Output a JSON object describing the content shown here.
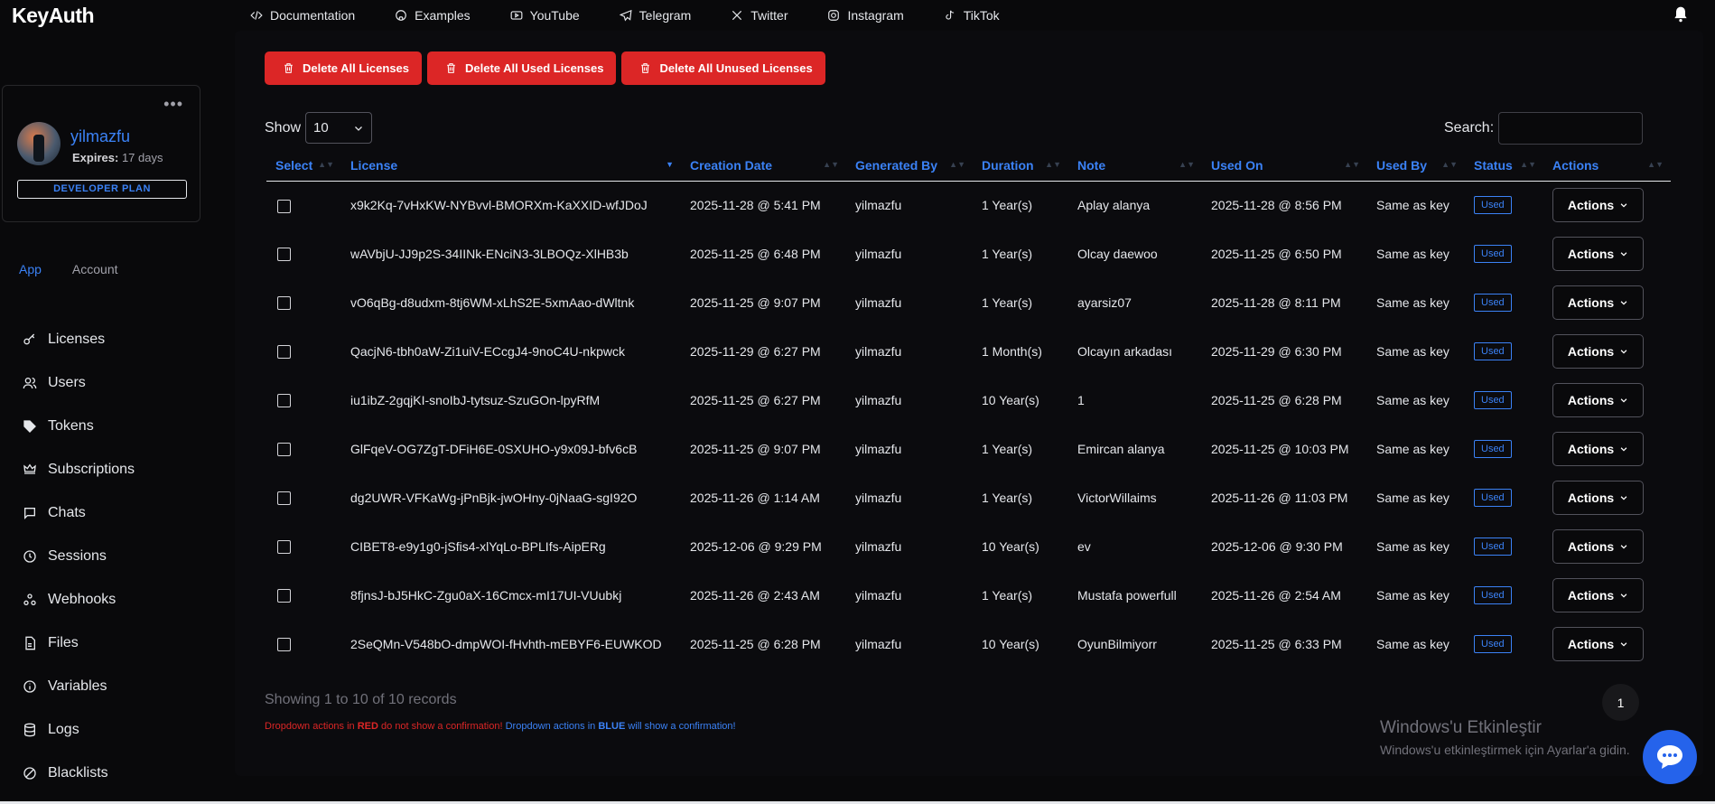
{
  "app": {
    "logo": "KeyAuth"
  },
  "topnav": [
    {
      "label": "Documentation",
      "icon": "code-icon"
    },
    {
      "label": "Examples",
      "icon": "github-icon"
    },
    {
      "label": "YouTube",
      "icon": "youtube-icon"
    },
    {
      "label": "Telegram",
      "icon": "telegram-icon"
    },
    {
      "label": "Twitter",
      "icon": "x-icon"
    },
    {
      "label": "Instagram",
      "icon": "instagram-icon"
    },
    {
      "label": "TikTok",
      "icon": "tiktok-icon"
    }
  ],
  "profile": {
    "username": "yilmazfu",
    "expires_label": "Expires:",
    "expires_value": "17 days",
    "plan": "DEVELOPER PLAN",
    "menu_dots": "•••"
  },
  "sidetabs": {
    "app": "App",
    "account": "Account"
  },
  "sidebar": [
    {
      "label": "Licenses"
    },
    {
      "label": "Users"
    },
    {
      "label": "Tokens"
    },
    {
      "label": "Subscriptions"
    },
    {
      "label": "Chats"
    },
    {
      "label": "Sessions"
    },
    {
      "label": "Webhooks"
    },
    {
      "label": "Files"
    },
    {
      "label": "Variables"
    },
    {
      "label": "Logs"
    },
    {
      "label": "Blacklists"
    }
  ],
  "actions_bar": {
    "delete_all": "Delete All Licenses",
    "delete_used": "Delete All Used Licenses",
    "delete_unused": "Delete All Unused Licenses"
  },
  "controls": {
    "show_label": "Show",
    "page_size": "10",
    "search_label": "Search:"
  },
  "table": {
    "headers": [
      "Select",
      "License",
      "Creation Date",
      "Generated By",
      "Duration",
      "Note",
      "Used On",
      "Used By",
      "Status",
      "Actions"
    ],
    "rows": [
      {
        "license": "x9k2Kq-7vHxKW-NYBvvl-BMORXm-KaXXID-wfJDoJ",
        "created": "2025-11-28 @ 5:41 PM",
        "by": "yilmazfu",
        "duration": "1 Year(s)",
        "note": "Aplay alanya",
        "used_on": "2025-11-28 @ 8:56 PM",
        "used_by": "Same as key",
        "status": "Used",
        "action": "Actions"
      },
      {
        "license": "wAVbjU-JJ9p2S-34IINk-ENciN3-3LBOQz-XlHB3b",
        "created": "2025-11-25 @ 6:48 PM",
        "by": "yilmazfu",
        "duration": "1 Year(s)",
        "note": "Olcay daewoo",
        "used_on": "2025-11-25 @ 6:50 PM",
        "used_by": "Same as key",
        "status": "Used",
        "action": "Actions"
      },
      {
        "license": "vO6qBg-d8udxm-8tj6WM-xLhS2E-5xmAao-dWltnk",
        "created": "2025-11-25 @ 9:07 PM",
        "by": "yilmazfu",
        "duration": "1 Year(s)",
        "note": "ayarsiz07",
        "used_on": "2025-11-28 @ 8:11 PM",
        "used_by": "Same as key",
        "status": "Used",
        "action": "Actions"
      },
      {
        "license": "QacjN6-tbh0aW-Zi1uiV-ECcgJ4-9noC4U-nkpwck",
        "created": "2025-11-29 @ 6:27 PM",
        "by": "yilmazfu",
        "duration": "1 Month(s)",
        "note": "Olcayın arkadası",
        "used_on": "2025-11-29 @ 6:30 PM",
        "used_by": "Same as key",
        "status": "Used",
        "action": "Actions"
      },
      {
        "license": "iu1ibZ-2gqjKI-snoIbJ-tytsuz-SzuGOn-lpyRfM",
        "created": "2025-11-25 @ 6:27 PM",
        "by": "yilmazfu",
        "duration": "10 Year(s)",
        "note": "1",
        "used_on": "2025-11-25 @ 6:28 PM",
        "used_by": "Same as key",
        "status": "Used",
        "action": "Actions"
      },
      {
        "license": "GlFqeV-OG7ZgT-DFiH6E-0SXUHO-y9x09J-bfv6cB",
        "created": "2025-11-25 @ 9:07 PM",
        "by": "yilmazfu",
        "duration": "1 Year(s)",
        "note": "Emircan alanya",
        "used_on": "2025-11-25 @ 10:03 PM",
        "used_by": "Same as key",
        "status": "Used",
        "action": "Actions"
      },
      {
        "license": "dg2UWR-VFKaWg-jPnBjk-jwOHny-0jNaaG-sgI92O",
        "created": "2025-11-26 @ 1:14 AM",
        "by": "yilmazfu",
        "duration": "1 Year(s)",
        "note": "VictorWillaims",
        "used_on": "2025-11-26 @ 11:03 PM",
        "used_by": "Same as key",
        "status": "Used",
        "action": "Actions"
      },
      {
        "license": "CIBET8-e9y1g0-jSfis4-xlYqLo-BPLIfs-AipERg",
        "created": "2025-12-06 @ 9:29 PM",
        "by": "yilmazfu",
        "duration": "10 Year(s)",
        "note": "ev",
        "used_on": "2025-12-06 @ 9:30 PM",
        "used_by": "Same as key",
        "status": "Used",
        "action": "Actions"
      },
      {
        "license": "8fjnsJ-bJ5HkC-Zgu0aX-16Cmcx-mI17UI-VUubkj",
        "created": "2025-11-26 @ 2:43 AM",
        "by": "yilmazfu",
        "duration": "1 Year(s)",
        "note": "Mustafa powerfull",
        "used_on": "2025-11-26 @ 2:54 AM",
        "used_by": "Same as key",
        "status": "Used",
        "action": "Actions"
      },
      {
        "license": "2SeQMn-V548bO-dmpWOI-fHvhth-mEBYF6-EUWKOD",
        "created": "2025-11-25 @ 6:28 PM",
        "by": "yilmazfu",
        "duration": "10 Year(s)",
        "note": "OyunBilmiyorr",
        "used_on": "2025-11-25 @ 6:33 PM",
        "used_by": "Same as key",
        "status": "Used",
        "action": "Actions"
      }
    ]
  },
  "footer": {
    "showing": "Showing 1 to 10 of 10 records",
    "page": "1",
    "legend_red_prefix": "Dropdown actions in ",
    "legend_red_word": "RED",
    "legend_red_suffix": " do not show a confirmation! ",
    "legend_blue_prefix": "Dropdown actions in ",
    "legend_blue_word": "BLUE",
    "legend_blue_suffix": " will show a confirmation!"
  },
  "windows_watermark": {
    "title": "Windows'u Etkinleştir",
    "subtitle": "Windows'u etkinleştirmek için Ayarlar'a gidin."
  },
  "colors": {
    "accent": "#3b82f6",
    "danger": "#dc2626",
    "background": "#09090b"
  }
}
